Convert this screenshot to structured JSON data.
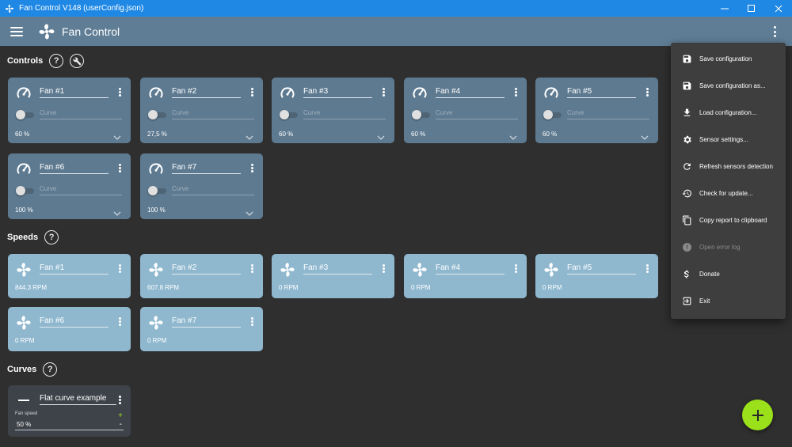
{
  "window": {
    "title": "Fan Control V148 (userConfig.json)",
    "controls": [
      "minimize",
      "maximize",
      "close"
    ]
  },
  "appbar": {
    "title": "Fan Control",
    "menu_icon": "hamburger-icon",
    "more_icon": "more-vert-icon"
  },
  "sections": {
    "controls": "Controls",
    "speeds": "Speeds",
    "curves": "Curves",
    "help_glyph": "?"
  },
  "controls": [
    {
      "name": "Fan #1",
      "curve_placeholder": "Curve",
      "value": "60 %"
    },
    {
      "name": "Fan #2",
      "curve_placeholder": "Curve",
      "value": "27,5 %"
    },
    {
      "name": "Fan #3",
      "curve_placeholder": "Curve",
      "value": "60 %"
    },
    {
      "name": "Fan #4",
      "curve_placeholder": "Curve",
      "value": "60 %"
    },
    {
      "name": "Fan #5",
      "curve_placeholder": "Curve",
      "value": "60 %"
    },
    {
      "name": "Fan #6",
      "curve_placeholder": "Curve",
      "value": "100 %"
    },
    {
      "name": "Fan #7",
      "curve_placeholder": "Curve",
      "value": "100 %"
    }
  ],
  "speeds": [
    {
      "name": "Fan #1",
      "value": "844.3 RPM"
    },
    {
      "name": "Fan #2",
      "value": "607.8 RPM"
    },
    {
      "name": "Fan #3",
      "value": "0 RPM"
    },
    {
      "name": "Fan #4",
      "value": "0 RPM"
    },
    {
      "name": "Fan #5",
      "value": "0 RPM"
    },
    {
      "name": "Fan #6",
      "value": "0 RPM"
    },
    {
      "name": "Fan #7",
      "value": "0 RPM"
    }
  ],
  "curves": [
    {
      "name": "Flat curve example",
      "field_label": "Fan speed",
      "value": "50 %",
      "plus": "+",
      "minus": "-"
    }
  ],
  "menu": {
    "items": [
      {
        "label": "Save configuration",
        "icon": "save-icon",
        "enabled": true
      },
      {
        "label": "Save configuration as...",
        "icon": "save-as-icon",
        "enabled": true
      },
      {
        "label": "Load configuration...",
        "icon": "download-icon",
        "enabled": true
      },
      {
        "label": "Sensor settings...",
        "icon": "gear-icon",
        "enabled": true
      },
      {
        "label": "Refresh sensors detection",
        "icon": "refresh-icon",
        "enabled": true
      },
      {
        "label": "Check for update...",
        "icon": "history-icon",
        "enabled": true
      },
      {
        "label": "Copy report to clipboard",
        "icon": "copy-icon",
        "enabled": true
      },
      {
        "label": "Open error log",
        "icon": "error-icon",
        "enabled": false
      },
      {
        "label": "Donate",
        "icon": "dollar-icon",
        "enabled": true
      },
      {
        "label": "Exit",
        "icon": "exit-icon",
        "enabled": true
      }
    ]
  },
  "fab": {
    "icon": "plus-icon"
  },
  "colors": {
    "titlebar": "#1f88e5",
    "appbar": "#5f7d95",
    "background": "#2f2f2f",
    "control_card": "#5e7a90",
    "speed_card": "#8fb8cf",
    "curve_card": "#3d4349",
    "accent": "#9ae01b"
  }
}
